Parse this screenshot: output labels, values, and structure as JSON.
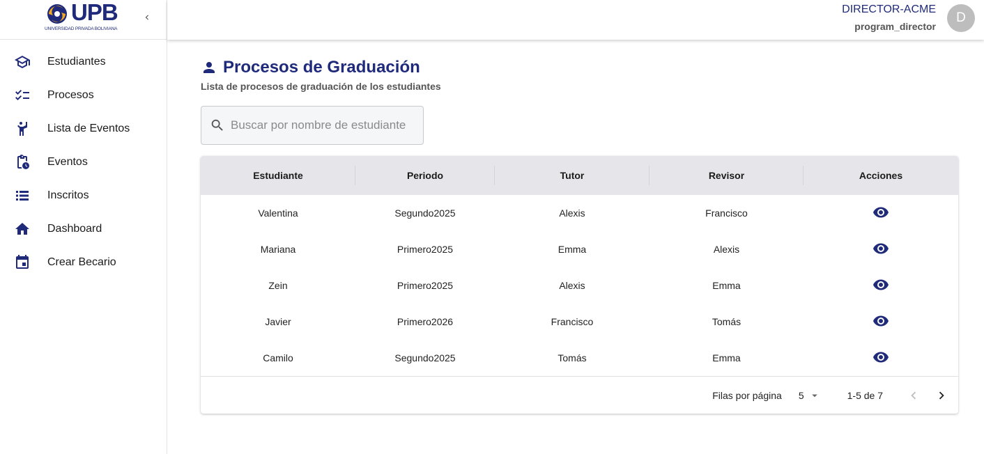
{
  "brand": {
    "logo_text": "UPB",
    "logo_subtext": "UNIVERSIDAD PRIVADA BOLIVIANA"
  },
  "sidebar": {
    "items": [
      {
        "label": "Estudiantes",
        "icon": "school-icon"
      },
      {
        "label": "Procesos",
        "icon": "checklist-icon"
      },
      {
        "label": "Lista de Eventos",
        "icon": "person-raising-hand-icon"
      },
      {
        "label": "Eventos",
        "icon": "clipboard-clock-icon"
      },
      {
        "label": "Inscritos",
        "icon": "list-icon"
      },
      {
        "label": "Dashboard",
        "icon": "home-icon"
      },
      {
        "label": "Crear Becario",
        "icon": "calendar-icon"
      }
    ]
  },
  "header": {
    "user_name": "DIRECTOR-ACME",
    "user_role": "program_director",
    "avatar_initial": "D"
  },
  "page": {
    "title": "Procesos de Graduación",
    "subtitle": "Lista de procesos de graduación de los estudiantes"
  },
  "search": {
    "placeholder": "Buscar por nombre de estudiante",
    "value": ""
  },
  "table": {
    "columns": [
      "Estudiante",
      "Periodo",
      "Tutor",
      "Revisor",
      "Acciones"
    ],
    "rows": [
      {
        "estudiante": "Valentina",
        "periodo": "Segundo2025",
        "tutor": "Alexis",
        "revisor": "Francisco"
      },
      {
        "estudiante": "Mariana",
        "periodo": "Primero2025",
        "tutor": "Emma",
        "revisor": "Alexis"
      },
      {
        "estudiante": "Zein",
        "periodo": "Primero2025",
        "tutor": "Alexis",
        "revisor": "Emma"
      },
      {
        "estudiante": "Javier",
        "periodo": "Primero2026",
        "tutor": "Francisco",
        "revisor": "Tomás"
      },
      {
        "estudiante": "Camilo",
        "periodo": "Segundo2025",
        "tutor": "Tomás",
        "revisor": "Emma"
      }
    ]
  },
  "pagination": {
    "rows_per_page_label": "Filas por página",
    "rows_per_page": "5",
    "range": "1-5 de 7"
  },
  "colors": {
    "primary": "#1f2a7a",
    "accent": "#f2a91e",
    "header_bg": "#e6e6ea"
  }
}
